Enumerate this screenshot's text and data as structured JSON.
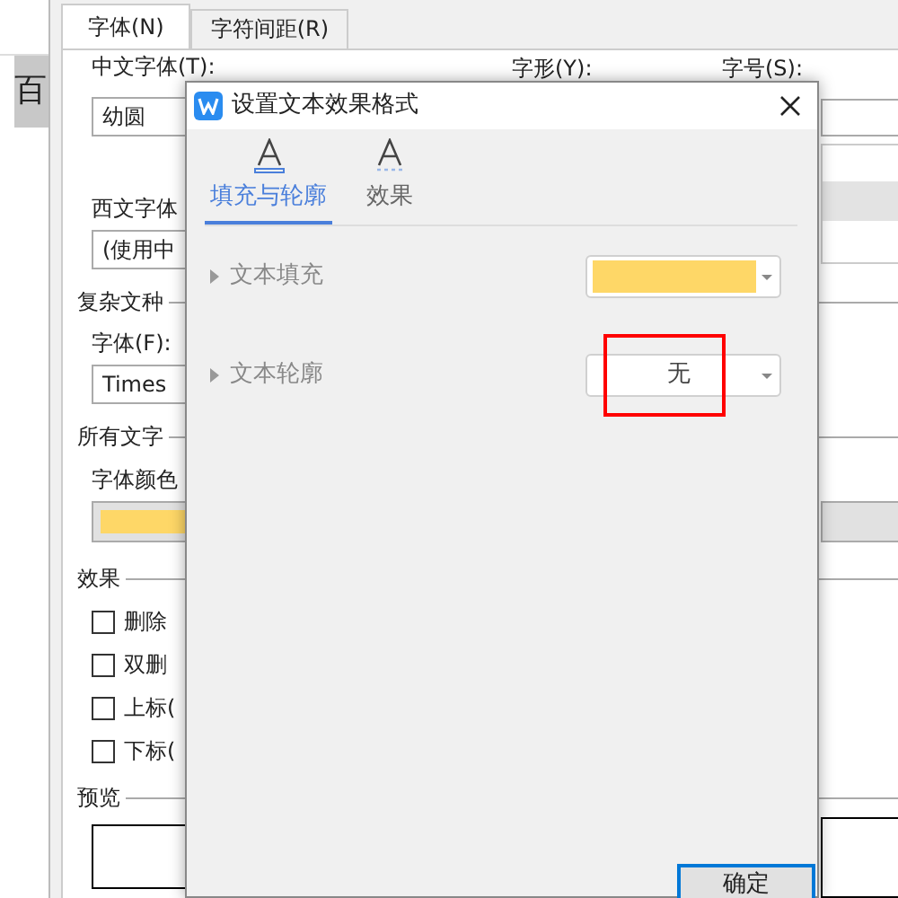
{
  "document": {
    "selected_text": "百"
  },
  "font_dialog": {
    "tabs": [
      {
        "label": "字体(N)",
        "selected": true
      },
      {
        "label": "字符间距(R)",
        "selected": false
      }
    ],
    "chinese_font": {
      "label": "中文字体(T):",
      "value": "幼圆"
    },
    "style_label": "字形(Y):",
    "size_label": "字号(S):",
    "western_font": {
      "label": "西文字体",
      "value": "(使用中"
    },
    "complex_group": "复杂文种",
    "complex_font": {
      "label": "字体(F):",
      "value": "Times"
    },
    "all_text_group": "所有文字",
    "font_color": {
      "label": "字体颜色",
      "color": "#fed767"
    },
    "effects_group": "效果",
    "effects": [
      {
        "label": "删除",
        "checked": false
      },
      {
        "label": "双删",
        "checked": false
      },
      {
        "label": "上标(",
        "checked": false
      },
      {
        "label": "下标(",
        "checked": false
      }
    ],
    "preview_group": "预览"
  },
  "text_effect_dialog": {
    "title": "设置文本效果格式",
    "tabs": [
      {
        "label": "填充与轮廓",
        "selected": true
      },
      {
        "label": "效果",
        "selected": false
      }
    ],
    "rows": [
      {
        "label": "文本填充",
        "kind": "color",
        "color": "#fed767"
      },
      {
        "label": "文本轮廓",
        "kind": "text",
        "value": "无",
        "highlighted": true
      }
    ],
    "ok_button": "确定"
  }
}
